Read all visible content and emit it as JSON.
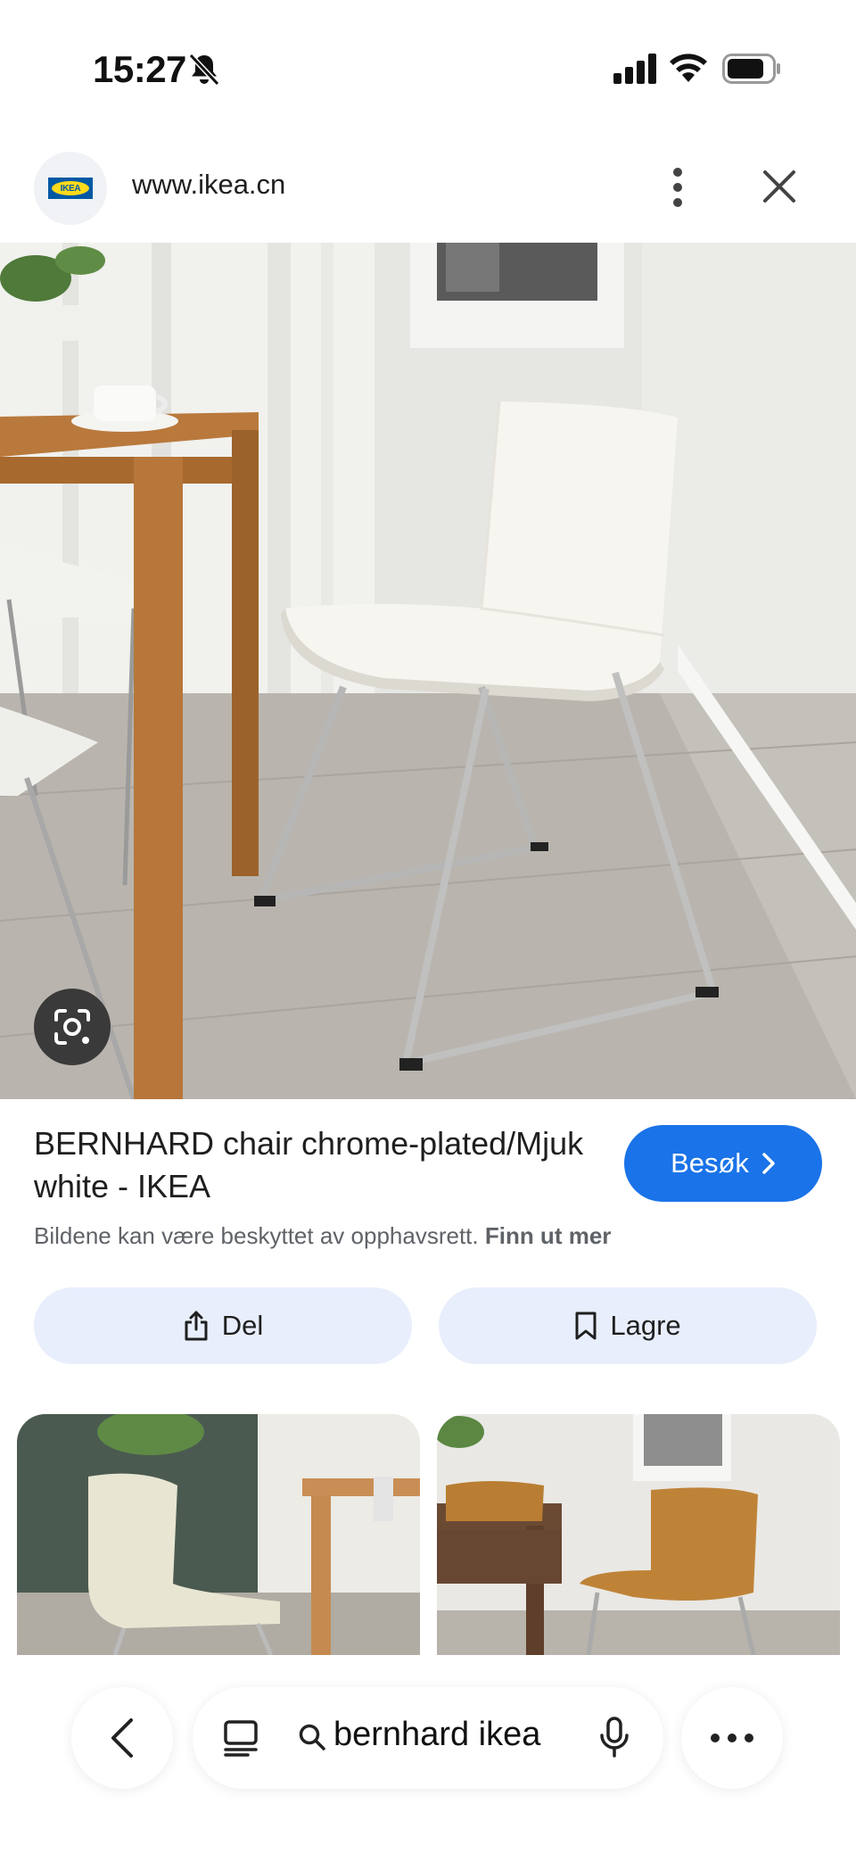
{
  "status_bar": {
    "time": "15:27"
  },
  "header": {
    "favicon_text": "IKEA",
    "url": "www.ikea.cn"
  },
  "result": {
    "title": "BERNHARD chair chrome-plated/Mjuk white - IKEA",
    "visit_label": "Besøk",
    "copyright_text": "Bildene kan være beskyttet av opphavsrett.",
    "learn_more": "Finn ut mer"
  },
  "actions": {
    "share_label": "Del",
    "save_label": "Lagre"
  },
  "bottom_bar": {
    "search_query": "bernhard ikea"
  },
  "colors": {
    "accent": "#1a73e8",
    "action_bg": "#e8eefb",
    "secondary_text": "#5f6368"
  }
}
